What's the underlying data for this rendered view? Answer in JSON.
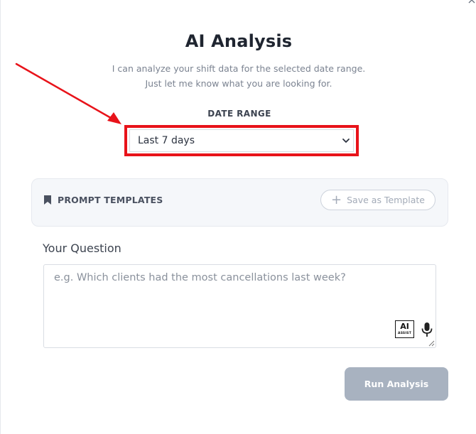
{
  "modal": {
    "title": "AI Analysis",
    "subtitle_line1": "I can analyze your shift data for the selected date range.",
    "subtitle_line2": "Just let me know what you are looking for."
  },
  "date_range": {
    "label": "DATE RANGE",
    "selected": "Last 7 days"
  },
  "prompt_templates": {
    "title": "PROMPT TEMPLATES",
    "save_label": "Save as Template"
  },
  "question": {
    "label": "Your Question",
    "placeholder": "e.g. Which clients had the most cancellations last week?",
    "ai_badge_main": "AI",
    "ai_badge_sub": "ASSIST"
  },
  "actions": {
    "run_label": "Run Analysis"
  },
  "colors": {
    "highlight": "#e8131a",
    "run_button": "#a8b2c0",
    "panel_bg": "#f5f7fa"
  },
  "icons": {
    "close": "close-icon",
    "bookmark": "bookmark-icon",
    "plus": "plus-icon",
    "chevron": "chevron-down-icon",
    "mic": "microphone-icon",
    "ai": "ai-assist-icon"
  }
}
